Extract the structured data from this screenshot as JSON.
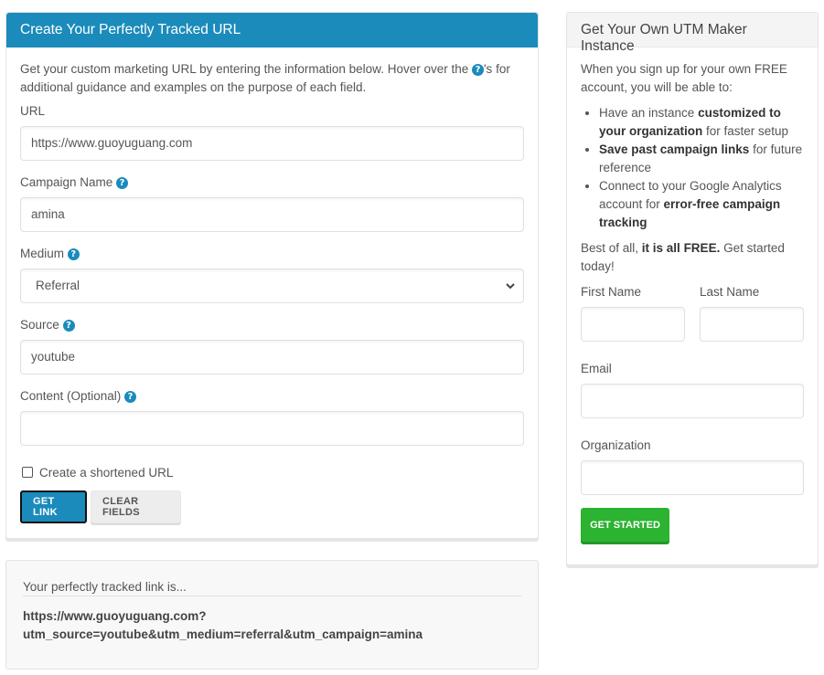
{
  "main_panel": {
    "title": "Create Your Perfectly Tracked URL",
    "intro_before": "Get your custom marketing URL by entering the information below. Hover over the ",
    "intro_after": "'s for additional guidance and examples on the purpose of each field.",
    "help_glyph": "?",
    "fields": {
      "url": {
        "label": "URL",
        "value": "https://www.guoyuguang.com"
      },
      "campaign": {
        "label": "Campaign Name",
        "value": "amina"
      },
      "medium": {
        "label": "Medium",
        "value": "Referral"
      },
      "source": {
        "label": "Source",
        "value": "youtube"
      },
      "content": {
        "label": "Content (Optional)",
        "value": ""
      }
    },
    "shorten_label": "Create a shortened URL",
    "shorten_checked": false,
    "get_link_label": "GET LINK",
    "clear_fields_label": "CLEAR FIELDS",
    "colors": {
      "accent": "#1a8bbb"
    }
  },
  "result_panel": {
    "title": "Your perfectly tracked link is...",
    "link_line1": "https://www.guoyuguang.com?",
    "link_line2": "utm_source=youtube&utm_medium=referral&utm_campaign=amina"
  },
  "side_panel": {
    "title": "Get Your Own UTM Maker Instance",
    "intro": "When you sign up for your own FREE account, you will be able to:",
    "bullets": [
      {
        "pre": "Have an instance ",
        "bold": "customized to your organization",
        "post": " for faster setup"
      },
      {
        "pre": "",
        "bold": "Save past campaign links",
        "post": " for future reference"
      },
      {
        "pre": "Connect to your Google Analytics account for ",
        "bold": "error-free campaign tracking",
        "post": ""
      }
    ],
    "closing_pre": "Best of all, ",
    "closing_bold": "it is all FREE.",
    "closing_post": " Get started today!",
    "first_name_label": "First Name",
    "last_name_label": "Last Name",
    "email_label": "Email",
    "organization_label": "Organization",
    "get_started_label": "GET STARTED",
    "colors": {
      "success": "#2bb331"
    }
  }
}
